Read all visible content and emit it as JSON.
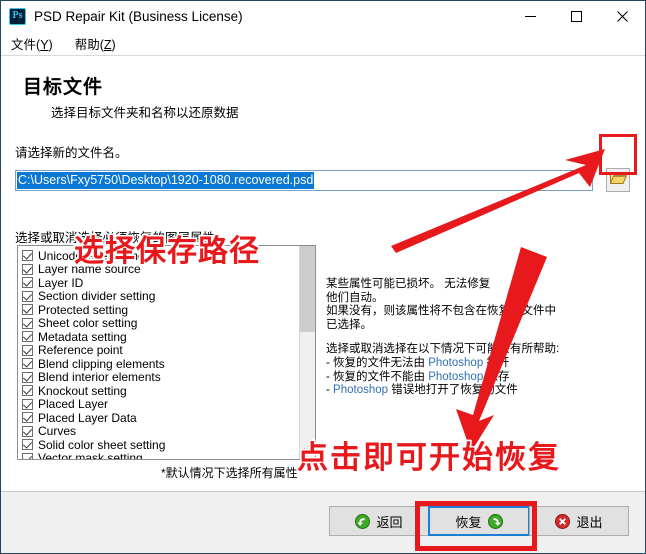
{
  "window": {
    "title": "PSD Repair Kit (Business License)",
    "app_icon": "photoshop-ps-icon",
    "minimize_label": "minimize-icon",
    "maximize_label": "maximize-icon",
    "close_label": "close-icon"
  },
  "menu": {
    "items": [
      {
        "label": "文件",
        "accel": "Y"
      },
      {
        "label": "帮助",
        "accel": "Z"
      }
    ]
  },
  "header": {
    "title": "目标文件",
    "subtitle": "选择目标文件夹和名称以还原数据"
  },
  "path": {
    "prompt": "请选择新的文件名。",
    "value": "C:\\Users\\Fxy5750\\Desktop\\1920-1080.recovered.psd",
    "browse_icon": "folder-open-icon"
  },
  "attributes": {
    "label": "选择或取消选择必须恢复的图层属性",
    "items": [
      "Unicode layer name",
      "Layer name source",
      "Layer ID",
      "Section divider setting",
      "Protected setting",
      "Sheet color setting",
      "Metadata setting",
      "Reference point",
      "Blend clipping elements",
      "Blend interior elements",
      "Knockout setting",
      "Placed Layer",
      "Placed Layer Data",
      "Curves",
      "Solid color sheet setting",
      "Vector mask setting"
    ],
    "all_checked": true,
    "footnote": "*默认情况下选择所有属性"
  },
  "info": {
    "paragraph1": [
      "某些属性可能已损坏。 无法修复",
      "他们自动。",
      "如果没有，则该属性将不包含在恢复的文件中",
      "已选择。"
    ],
    "paragraph2_title": "选择或取消选择在以下情况下可能会有所帮助:",
    "bullets": [
      {
        "pre": "- 恢复的文件无法由 ",
        "app": "Photoshop",
        "post": " 打开"
      },
      {
        "pre": "- 恢复的文件不能由 ",
        "app": "Photoshop",
        "post": " 保存"
      },
      {
        "pre": "- ",
        "app": "Photoshop",
        "post": " 错误地打开了恢复的文件"
      }
    ]
  },
  "footer": {
    "back_label": "返回",
    "back_icon": "arrow-left-circle-icon",
    "recover_label": "恢复",
    "recover_icon": "arrow-right-circle-icon",
    "exit_label": "退出",
    "exit_icon": "close-circle-icon"
  },
  "annotations": {
    "select_path_text": "选择保存路径",
    "click_to_start_text": "点击即可开始恢复",
    "color": "#e8191c"
  }
}
